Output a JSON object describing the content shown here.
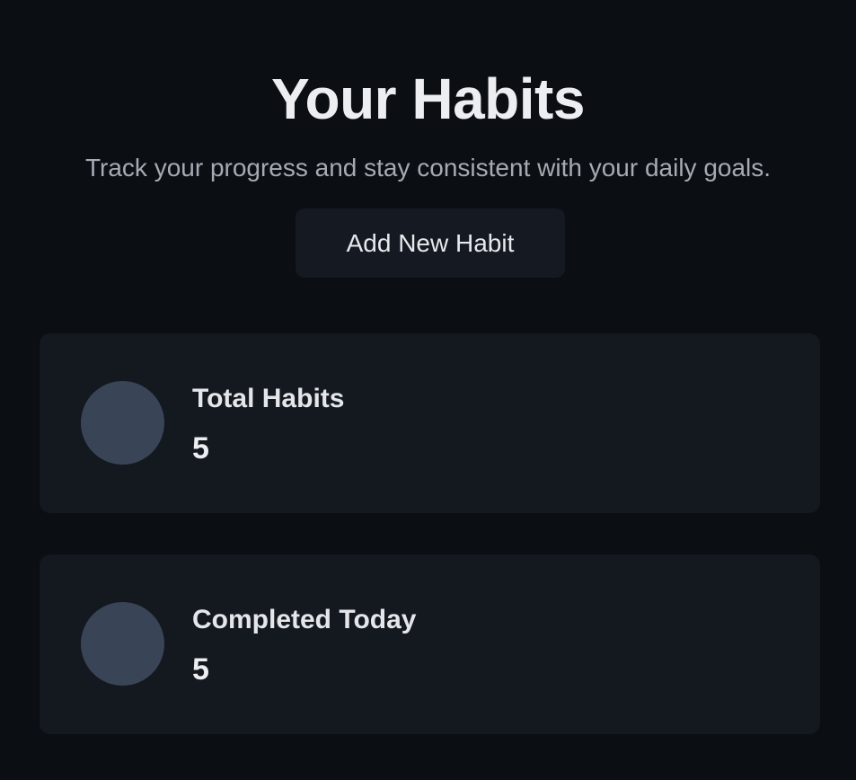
{
  "header": {
    "title": "Your Habits",
    "subtitle": "Track your progress and stay consistent with your daily goals.",
    "add_button_label": "Add New Habit"
  },
  "stats": [
    {
      "label": "Total Habits",
      "value": "5"
    },
    {
      "label": "Completed Today",
      "value": "5"
    }
  ],
  "colors": {
    "background": "#0b0e13",
    "card": "#141920",
    "button": "#151a22",
    "avatar": "#394457",
    "text_primary": "#eceef1",
    "text_muted": "#a6aab3"
  }
}
